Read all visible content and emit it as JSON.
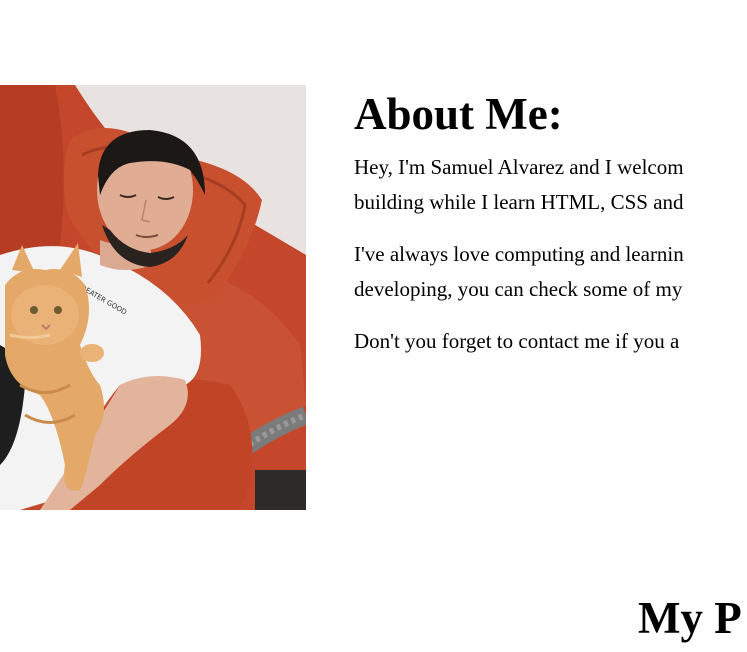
{
  "about": {
    "heading": "About Me:",
    "paragraphs": [
      [
        "Hey, I'm Samuel Alvarez and I welcom",
        "building while I learn HTML, CSS and"
      ],
      [
        "I've always love computing and learnin",
        "developing, you can check some of my"
      ],
      [
        "Don't you forget to contact me if you a"
      ]
    ]
  },
  "photo": {
    "shirt_text": "A GREATER GOOD"
  },
  "projects": {
    "heading_visible": "My P"
  },
  "colors": {
    "background": "#ffffff",
    "text": "#000000",
    "couch": "#c8472a",
    "wall": "#e9e4e2",
    "shirt": "#f4f4f4",
    "cat": "#e3a865"
  }
}
